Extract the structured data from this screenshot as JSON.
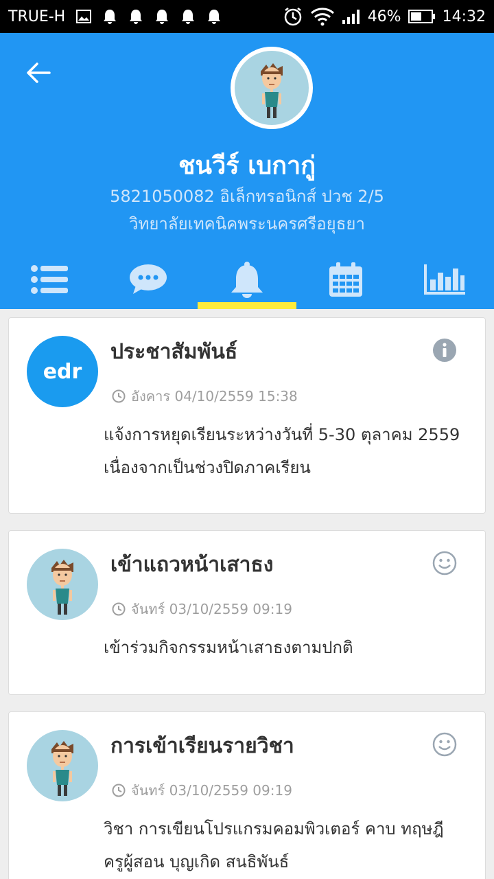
{
  "status_bar": {
    "carrier": "TRUE-H",
    "battery": "46%",
    "time": "14:32"
  },
  "profile": {
    "name": "ชนวีร์ เบกากู่",
    "id_line": "5821050082 อิเล็กทรอนิกส์ ปวช 2/5",
    "school": "วิทยาลัยเทคนิคพระนครศรีอยุธยา"
  },
  "tabs": [
    {
      "icon": "list-icon"
    },
    {
      "icon": "chat-icon"
    },
    {
      "icon": "bell-icon",
      "active": true
    },
    {
      "icon": "calendar-icon"
    },
    {
      "icon": "bar-chart-icon"
    }
  ],
  "feed": [
    {
      "avatar": "edr",
      "avatar_text": "edr",
      "title": "ประชาสัมพันธ์",
      "time": "อังคาร 04/10/2559  15:38",
      "body": "แจ้งการหยุดเรียนระหว่างวันที่ 5-30 ตุลาคม 2559 เนื่องจากเป็นช่วงปิดภาคเรียน",
      "action_icon": "info-icon"
    },
    {
      "avatar": "student",
      "title": "เข้าแถวหน้าเสาธง",
      "time": "จันทร์ 03/10/2559  09:19",
      "body": "เข้าร่วมกิจกรรมหน้าเสาธงตามปกติ",
      "action_icon": "smiley-icon"
    },
    {
      "avatar": "student",
      "title": "การเข้าเรียนรายวิชา",
      "time": "จันทร์ 03/10/2559  09:19",
      "body": "วิชา การเขียนโปรแกรมคอมพิวเตอร์ คาบ ทฤษฎี ครูผู้สอน บุญเกิด สนธิพันธ์",
      "action_icon": "smiley-icon"
    }
  ],
  "colors": {
    "header_bg": "#2196f3",
    "tab_indicator": "#ffeb3b",
    "edr_logo": "#1a9bef"
  }
}
